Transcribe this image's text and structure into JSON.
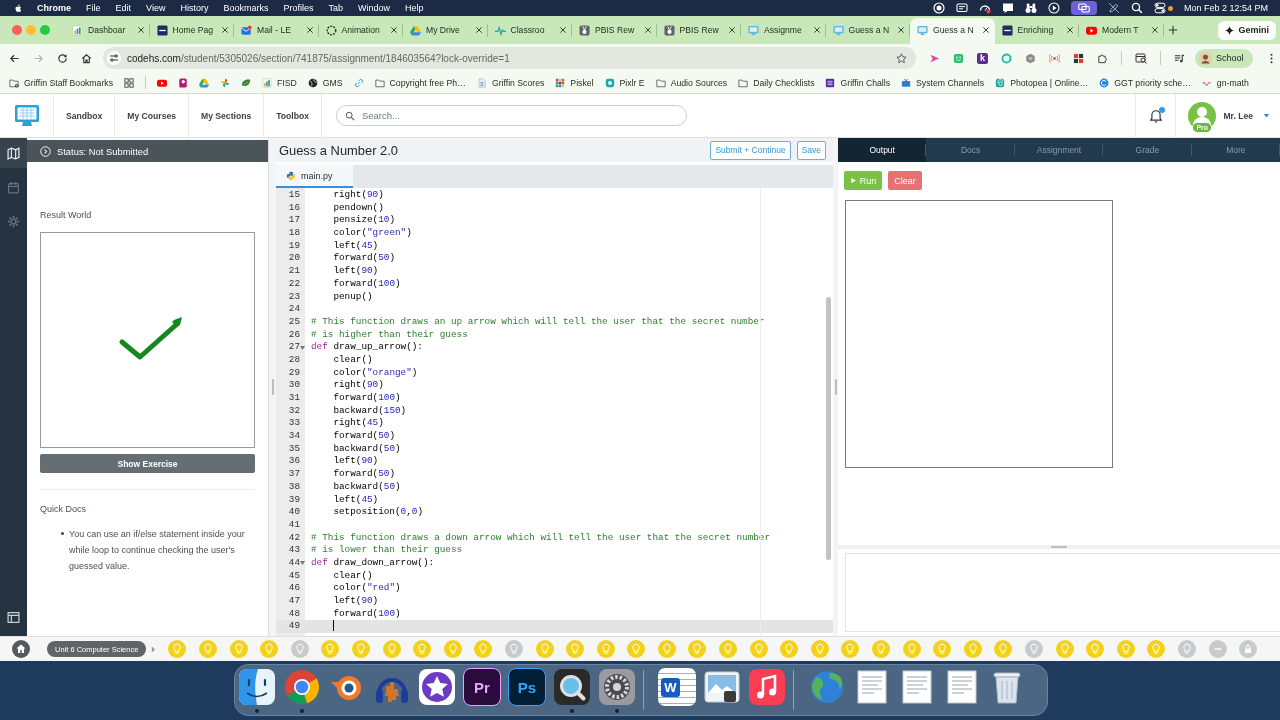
{
  "menu_bar": {
    "app_name": "Chrome",
    "menus": [
      "File",
      "Edit",
      "View",
      "History",
      "Bookmarks",
      "Profiles",
      "Tab",
      "Window",
      "Help"
    ],
    "status_icons": [
      {
        "kind": "record",
        "active": false
      },
      {
        "kind": "display",
        "active": false
      },
      {
        "kind": "gauge",
        "active": false
      },
      {
        "kind": "message",
        "active": false
      },
      {
        "kind": "binoculars",
        "active": false
      },
      {
        "kind": "play",
        "active": false
      },
      {
        "kind": "mirror",
        "active": true
      },
      {
        "kind": "pen-off",
        "active": false
      },
      {
        "kind": "search",
        "active": false
      },
      {
        "kind": "controls",
        "active": false
      }
    ],
    "mic_indicator": true,
    "clock": "Mon Feb 2 12:54 PM"
  },
  "browser": {
    "tabs": [
      {
        "title": "Dashboar",
        "kind": "chart",
        "selected": false
      },
      {
        "title": "Home Pag",
        "kind": "tile",
        "selected": false
      },
      {
        "title": "Mail - LE",
        "kind": "mail",
        "selected": false
      },
      {
        "title": "Animation",
        "kind": "ring",
        "selected": false
      },
      {
        "title": "My Drive",
        "kind": "drive",
        "selected": false
      },
      {
        "title": "Classroo",
        "kind": "pulse",
        "selected": false
      },
      {
        "title": "PBIS Rew",
        "kind": "medal",
        "selected": false
      },
      {
        "title": "PBIS Rew",
        "kind": "medal",
        "selected": false
      },
      {
        "title": "Assignme",
        "kind": "monitor",
        "selected": false
      },
      {
        "title": "Guess a N",
        "kind": "monitor",
        "selected": false
      },
      {
        "title": "Guess a N",
        "kind": "monitor",
        "selected": true
      },
      {
        "title": "Enriching",
        "kind": "tile",
        "selected": false
      },
      {
        "title": "Modern T",
        "kind": "video",
        "selected": false
      }
    ],
    "gemini_label": "Gemini",
    "navigation": {
      "back_enabled": true,
      "forward_enabled": false
    },
    "address": {
      "host": "codehs.com",
      "path": "/student/5305026/section/741875/assignment/184603564?lock-override=1"
    },
    "bookmarked": false,
    "extensions": [
      {
        "kind": "arrow"
      },
      {
        "kind": "face"
      },
      {
        "kind": "letter",
        "glyph": "k"
      },
      {
        "kind": "ring"
      },
      {
        "kind": "hexagon"
      },
      {
        "kind": "broadcast"
      },
      {
        "kind": "grid"
      },
      {
        "kind": "puzzle"
      }
    ],
    "profile_label": "School",
    "bookmarks": [
      {
        "kind": "folder-gear",
        "label": "Griffin Staff Bookmarks"
      },
      {
        "kind": "apps"
      },
      {
        "kind": "separator"
      },
      {
        "kind": "video"
      },
      {
        "kind": "tile-p"
      },
      {
        "kind": "drive"
      },
      {
        "kind": "pinwheel"
      },
      {
        "kind": "leaf"
      },
      {
        "kind": "chart",
        "label": "FISD"
      },
      {
        "kind": "globe",
        "label": "GMS"
      },
      {
        "kind": "link"
      },
      {
        "kind": "folder",
        "label": "Copyright free Ph…"
      },
      {
        "kind": "document",
        "label": "Griffin Scores"
      },
      {
        "kind": "pixels",
        "label": "Piskel"
      },
      {
        "kind": "tile-eye",
        "label": "Pixlr E"
      },
      {
        "kind": "folder",
        "label": "Audio Sources"
      },
      {
        "kind": "folder",
        "label": "Daily Checklists"
      },
      {
        "kind": "list",
        "label": "Griffin Challs"
      },
      {
        "kind": "tv",
        "label": "System Channels"
      },
      {
        "kind": "swirl",
        "label": "Photopea | Online…"
      },
      {
        "kind": "circle",
        "label": "GGT priority sche…"
      },
      {
        "kind": "squiggle",
        "label": "gn-math"
      }
    ]
  },
  "codehs_nav": {
    "links": [
      "Sandbox",
      "My Courses",
      "My Sections",
      "Toolbox"
    ],
    "search_placeholder": "Search...",
    "has_notification": true,
    "badge": "Pro",
    "user_name": "Mr. Lee"
  },
  "sidebar": {
    "items": [
      {
        "kind": "map",
        "selected": true
      },
      {
        "kind": "calendar",
        "selected": false
      },
      {
        "kind": "settings",
        "selected": false
      }
    ]
  },
  "result_panel": {
    "status": "Status: Not Submitted",
    "heading": "Result World",
    "button": "Show Exercise",
    "docs_heading": "Quick Docs",
    "docs": [
      "You can use an if/else statement inside your while loop to continue checking the user's guessed value."
    ]
  },
  "editor": {
    "title": "Guess a Number 2.0",
    "buttons": [
      "Submit + Continue",
      "Save"
    ],
    "files": [
      {
        "name": "main.py",
        "selected": true
      }
    ],
    "lines": [
      {
        "number": "15",
        "foldable": false,
        "active": false,
        "segments": [
          {
            "text": "    right(",
            "kind": "plain"
          },
          {
            "text": "90",
            "kind": "number"
          },
          {
            "text": ")",
            "kind": "plain"
          }
        ]
      },
      {
        "number": "16",
        "foldable": false,
        "active": false,
        "segments": [
          {
            "text": "    pendown()",
            "kind": "plain"
          }
        ]
      },
      {
        "number": "17",
        "foldable": false,
        "active": false,
        "segments": [
          {
            "text": "    pensize(",
            "kind": "plain"
          },
          {
            "text": "10",
            "kind": "number"
          },
          {
            "text": ")",
            "kind": "plain"
          }
        ]
      },
      {
        "number": "18",
        "foldable": false,
        "active": false,
        "segments": [
          {
            "text": "    color(",
            "kind": "plain"
          },
          {
            "text": "\"green\"",
            "kind": "string"
          },
          {
            "text": ")",
            "kind": "plain"
          }
        ]
      },
      {
        "number": "19",
        "foldable": false,
        "active": false,
        "segments": [
          {
            "text": "    left(",
            "kind": "plain"
          },
          {
            "text": "45",
            "kind": "number"
          },
          {
            "text": ")",
            "kind": "plain"
          }
        ]
      },
      {
        "number": "20",
        "foldable": false,
        "active": false,
        "segments": [
          {
            "text": "    forward(",
            "kind": "plain"
          },
          {
            "text": "50",
            "kind": "number"
          },
          {
            "text": ")",
            "kind": "plain"
          }
        ]
      },
      {
        "number": "21",
        "foldable": false,
        "active": false,
        "segments": [
          {
            "text": "    left(",
            "kind": "plain"
          },
          {
            "text": "90",
            "kind": "number"
          },
          {
            "text": ")",
            "kind": "plain"
          }
        ]
      },
      {
        "number": "22",
        "foldable": false,
        "active": false,
        "segments": [
          {
            "text": "    forward(",
            "kind": "plain"
          },
          {
            "text": "100",
            "kind": "number"
          },
          {
            "text": ")",
            "kind": "plain"
          }
        ]
      },
      {
        "number": "23",
        "foldable": false,
        "active": false,
        "segments": [
          {
            "text": "    penup()",
            "kind": "plain"
          }
        ]
      },
      {
        "number": "24",
        "foldable": false,
        "active": false
      },
      {
        "number": "25",
        "foldable": false,
        "active": false,
        "segments": [
          {
            "text": "# This function draws an up arrow which will tell the user that the secret number",
            "kind": "comment"
          }
        ]
      },
      {
        "number": "26",
        "foldable": false,
        "active": false,
        "segments": [
          {
            "text": "# is higher than their guess",
            "kind": "comment"
          }
        ]
      },
      {
        "number": "27",
        "foldable": true,
        "active": false,
        "segments": [
          {
            "text": "def",
            "kind": "keyword"
          },
          {
            "text": " draw_up_arrow():",
            "kind": "plain"
          }
        ]
      },
      {
        "number": "28",
        "foldable": false,
        "active": false,
        "segments": [
          {
            "text": "    clear()",
            "kind": "plain"
          }
        ]
      },
      {
        "number": "29",
        "foldable": false,
        "active": false,
        "segments": [
          {
            "text": "    color(",
            "kind": "plain"
          },
          {
            "text": "\"orange\"",
            "kind": "string"
          },
          {
            "text": ")",
            "kind": "plain"
          }
        ]
      },
      {
        "number": "30",
        "foldable": false,
        "active": false,
        "segments": [
          {
            "text": "    right(",
            "kind": "plain"
          },
          {
            "text": "90",
            "kind": "number"
          },
          {
            "text": ")",
            "kind": "plain"
          }
        ]
      },
      {
        "number": "31",
        "foldable": false,
        "active": false,
        "segments": [
          {
            "text": "    forward(",
            "kind": "plain"
          },
          {
            "text": "100",
            "kind": "number"
          },
          {
            "text": ")",
            "kind": "plain"
          }
        ]
      },
      {
        "number": "32",
        "foldable": false,
        "active": false,
        "segments": [
          {
            "text": "    backward(",
            "kind": "plain"
          },
          {
            "text": "150",
            "kind": "number"
          },
          {
            "text": ")",
            "kind": "plain"
          }
        ]
      },
      {
        "number": "33",
        "foldable": false,
        "active": false,
        "segments": [
          {
            "text": "    right(",
            "kind": "plain"
          },
          {
            "text": "45",
            "kind": "number"
          },
          {
            "text": ")",
            "kind": "plain"
          }
        ]
      },
      {
        "number": "34",
        "foldable": false,
        "active": false,
        "segments": [
          {
            "text": "    forward(",
            "kind": "plain"
          },
          {
            "text": "50",
            "kind": "number"
          },
          {
            "text": ")",
            "kind": "plain"
          }
        ]
      },
      {
        "number": "35",
        "foldable": false,
        "active": false,
        "segments": [
          {
            "text": "    backward(",
            "kind": "plain"
          },
          {
            "text": "50",
            "kind": "number"
          },
          {
            "text": ")",
            "kind": "plain"
          }
        ]
      },
      {
        "number": "36",
        "foldable": false,
        "active": false,
        "segments": [
          {
            "text": "    left(",
            "kind": "plain"
          },
          {
            "text": "90",
            "kind": "number"
          },
          {
            "text": ")",
            "kind": "plain"
          }
        ]
      },
      {
        "number": "37",
        "foldable": false,
        "active": false,
        "segments": [
          {
            "text": "    forward(",
            "kind": "plain"
          },
          {
            "text": "50",
            "kind": "number"
          },
          {
            "text": ")",
            "kind": "plain"
          }
        ]
      },
      {
        "number": "38",
        "foldable": false,
        "active": false,
        "segments": [
          {
            "text": "    backward(",
            "kind": "plain"
          },
          {
            "text": "50",
            "kind": "number"
          },
          {
            "text": ")",
            "kind": "plain"
          }
        ]
      },
      {
        "number": "39",
        "foldable": false,
        "active": false,
        "segments": [
          {
            "text": "    left(",
            "kind": "plain"
          },
          {
            "text": "45",
            "kind": "number"
          },
          {
            "text": ")",
            "kind": "plain"
          }
        ]
      },
      {
        "number": "40",
        "foldable": false,
        "active": false,
        "segments": [
          {
            "text": "    setposition(",
            "kind": "plain"
          },
          {
            "text": "0",
            "kind": "number"
          },
          {
            "text": ",",
            "kind": "plain"
          },
          {
            "text": "0",
            "kind": "number"
          },
          {
            "text": ")",
            "kind": "plain"
          }
        ]
      },
      {
        "number": "41",
        "foldable": false,
        "active": false
      },
      {
        "number": "42",
        "foldable": false,
        "active": false,
        "segments": [
          {
            "text": "# This function draws a down arrow which will tell the user that the secret number",
            "kind": "comment"
          }
        ]
      },
      {
        "number": "43",
        "foldable": false,
        "active": false,
        "segments": [
          {
            "text": "# is lower than their guess",
            "kind": "comment"
          }
        ]
      },
      {
        "number": "44",
        "foldable": true,
        "active": false,
        "segments": [
          {
            "text": "def",
            "kind": "keyword"
          },
          {
            "text": " draw_down_arrow():",
            "kind": "plain"
          }
        ]
      },
      {
        "number": "45",
        "foldable": false,
        "active": false,
        "segments": [
          {
            "text": "    clear()",
            "kind": "plain"
          }
        ]
      },
      {
        "number": "46",
        "foldable": false,
        "active": false,
        "segments": [
          {
            "text": "    color(",
            "kind": "plain"
          },
          {
            "text": "\"red\"",
            "kind": "string"
          },
          {
            "text": ")",
            "kind": "plain"
          }
        ]
      },
      {
        "number": "47",
        "foldable": false,
        "active": false,
        "segments": [
          {
            "text": "    left(",
            "kind": "plain"
          },
          {
            "text": "90",
            "kind": "number"
          },
          {
            "text": ")",
            "kind": "plain"
          }
        ]
      },
      {
        "number": "48",
        "foldable": false,
        "active": false,
        "segments": [
          {
            "text": "    forward(",
            "kind": "plain"
          },
          {
            "text": "100",
            "kind": "number"
          },
          {
            "text": ")",
            "kind": "plain"
          }
        ]
      },
      {
        "number": "49",
        "foldable": false,
        "active": true
      }
    ]
  },
  "output_panel": {
    "tabs": [
      {
        "label": "Output",
        "selected": true
      },
      {
        "label": "Docs",
        "selected": false
      },
      {
        "label": "Assignment",
        "selected": false
      },
      {
        "label": "Grade",
        "selected": false
      },
      {
        "label": "More",
        "selected": false
      }
    ],
    "run_label": "Run",
    "clear_label": "Clear"
  },
  "progress_bar": {
    "unit": "Unit 6 Computer Science",
    "items": [
      {
        "kind": "bulb",
        "completed": true
      },
      {
        "kind": "bulb",
        "completed": true
      },
      {
        "kind": "bulb",
        "completed": true
      },
      {
        "kind": "bulb",
        "completed": true
      },
      {
        "kind": "bulb",
        "completed": false
      },
      {
        "kind": "bulb",
        "completed": true
      },
      {
        "kind": "bulb",
        "completed": true
      },
      {
        "kind": "bulb",
        "completed": true
      },
      {
        "kind": "bulb",
        "completed": true
      },
      {
        "kind": "bulb",
        "completed": true
      },
      {
        "kind": "bulb",
        "completed": true
      },
      {
        "kind": "bulb",
        "completed": false
      },
      {
        "kind": "bulb",
        "completed": true
      },
      {
        "kind": "bulb",
        "completed": true
      },
      {
        "kind": "bulb",
        "completed": true
      },
      {
        "kind": "bulb",
        "completed": true
      },
      {
        "kind": "bulb",
        "completed": true
      },
      {
        "kind": "bulb",
        "completed": true
      },
      {
        "kind": "bulb",
        "completed": true
      },
      {
        "kind": "bulb",
        "completed": true
      },
      {
        "kind": "bulb",
        "completed": true
      },
      {
        "kind": "bulb",
        "completed": true
      },
      {
        "kind": "bulb",
        "completed": true
      },
      {
        "kind": "bulb",
        "completed": true
      },
      {
        "kind": "bulb",
        "completed": true
      },
      {
        "kind": "bulb",
        "completed": true
      },
      {
        "kind": "bulb",
        "completed": true
      },
      {
        "kind": "bulb",
        "completed": true
      },
      {
        "kind": "bulb",
        "completed": false
      },
      {
        "kind": "bulb",
        "completed": true
      },
      {
        "kind": "bulb",
        "completed": true
      },
      {
        "kind": "bulb",
        "completed": true
      },
      {
        "kind": "bulb",
        "completed": true
      },
      {
        "kind": "bulb",
        "completed": false
      },
      {
        "kind": "dash",
        "completed": false
      },
      {
        "kind": "lock",
        "completed": false
      }
    ]
  },
  "dock": {
    "apps": [
      {
        "kind": "finder",
        "running": true
      },
      {
        "kind": "chrome",
        "running": true
      },
      {
        "kind": "blender",
        "running": false
      },
      {
        "kind": "audio",
        "running": false
      },
      {
        "kind": "star",
        "running": false
      },
      {
        "kind": "premiere",
        "glyph": "Pr",
        "running": false
      },
      {
        "kind": "photoshop",
        "glyph": "Ps",
        "running": false
      },
      {
        "kind": "quicktime",
        "running": true
      },
      {
        "kind": "settings",
        "running": true
      },
      {
        "kind": "separator"
      },
      {
        "kind": "word",
        "glyph": "W",
        "running": false
      },
      {
        "kind": "photo",
        "running": false
      },
      {
        "kind": "music",
        "running": false
      },
      {
        "kind": "separator"
      },
      {
        "kind": "globe",
        "running": false
      },
      {
        "kind": "document",
        "running": false
      },
      {
        "kind": "document",
        "running": false
      },
      {
        "kind": "document",
        "running": false
      },
      {
        "kind": "trash",
        "running": false
      }
    ]
  }
}
